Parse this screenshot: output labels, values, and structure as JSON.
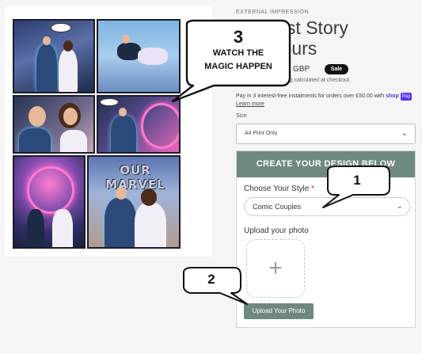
{
  "product": {
    "vendor": "EXTERNAL IMPRESSION",
    "title_line1": "...eatest Story",
    "title_line2": "...d: Yours",
    "price_currency": "GBP",
    "sale_badge": "Sale",
    "tax_note": "VAT included. Shipping calculated at checkout.",
    "installments_text": "Pay in 3 interest-free instalments for orders over £50.00 with",
    "shoppay_label": "shop",
    "shoppay_tag": "Pay",
    "learn_more": "Learn more",
    "size_label": "Size",
    "size_value": "A4 Print Only"
  },
  "design": {
    "header": "CREATE YOUR DESIGN BELOW",
    "style_label": "Choose Your Style",
    "required_mark": "*",
    "style_value": "Comic Couples",
    "upload_label": "Upload your photo",
    "plus_symbol": "+",
    "upload_button": "Upload Your Photo"
  },
  "image": {
    "comic_title": "OUR MARVEL"
  },
  "callouts": {
    "step3_number": "3",
    "step3_line1": "WATCH THE",
    "step3_line2": "MAGIC HAPPEN",
    "step1_number": "1",
    "step2_number": "2"
  },
  "icons": {
    "size_chevron": "chevron-down-icon",
    "style_chevron": "chevron-down-icon",
    "upload_plus": "plus-icon"
  },
  "colors": {
    "accent": "#6e8a80",
    "sale_badge": "#121212",
    "required": "#d2232a",
    "shoppay": "#5a31f4"
  }
}
